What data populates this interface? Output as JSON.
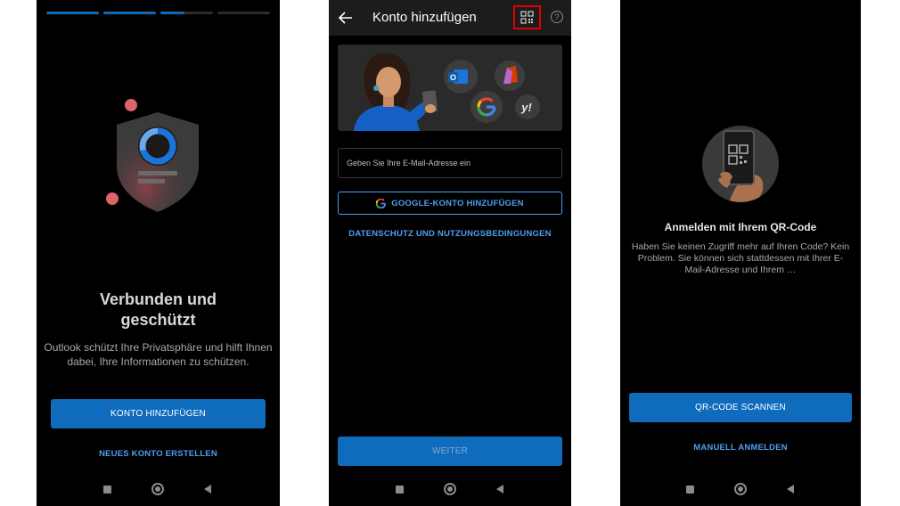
{
  "panel1": {
    "title_line1": "Verbunden und",
    "title_line2": "geschützt",
    "description": "Outlook schützt Ihre Privatsphäre und hilft Ihnen dabei, Ihre Informationen zu schützen.",
    "add_account_label": "KONTO HINZUFÜGEN",
    "new_account_label": "NEUES KONTO ERSTELLEN",
    "progress": {
      "steps": 4,
      "completed": 2,
      "current_fraction": 0.45
    }
  },
  "panel2": {
    "header_title": "Konto hinzufügen",
    "help_glyph": "?",
    "email_placeholder": "Geben Sie Ihre E-Mail-Adresse ein",
    "google_button_label": "GOOGLE-KONTO HINZUFÜGEN",
    "privacy_link_label": "DATENSCHUTZ UND NUTZUNGSBEDINGUNGEN",
    "next_button_label": "WEITER",
    "icons": [
      "back-arrow-icon",
      "qr-code-icon",
      "help-icon",
      "outlook-icon",
      "office-icon",
      "google-icon",
      "yahoo-icon"
    ]
  },
  "panel3": {
    "title": "Anmelden mit Ihrem QR-Code",
    "description": "Haben Sie keinen Zugriff mehr auf Ihren Code? Kein Problem. Sie können sich stattdessen mit Ihrer E-Mail-Adresse und Ihrem …",
    "scan_button_label": "QR-CODE SCANNEN",
    "manual_link_label": "MANUELL ANMELDEN"
  },
  "colors": {
    "accent": "#0f6cbd",
    "link": "#4f9ef0",
    "highlight_box": "#e00000",
    "background": "#000000"
  }
}
